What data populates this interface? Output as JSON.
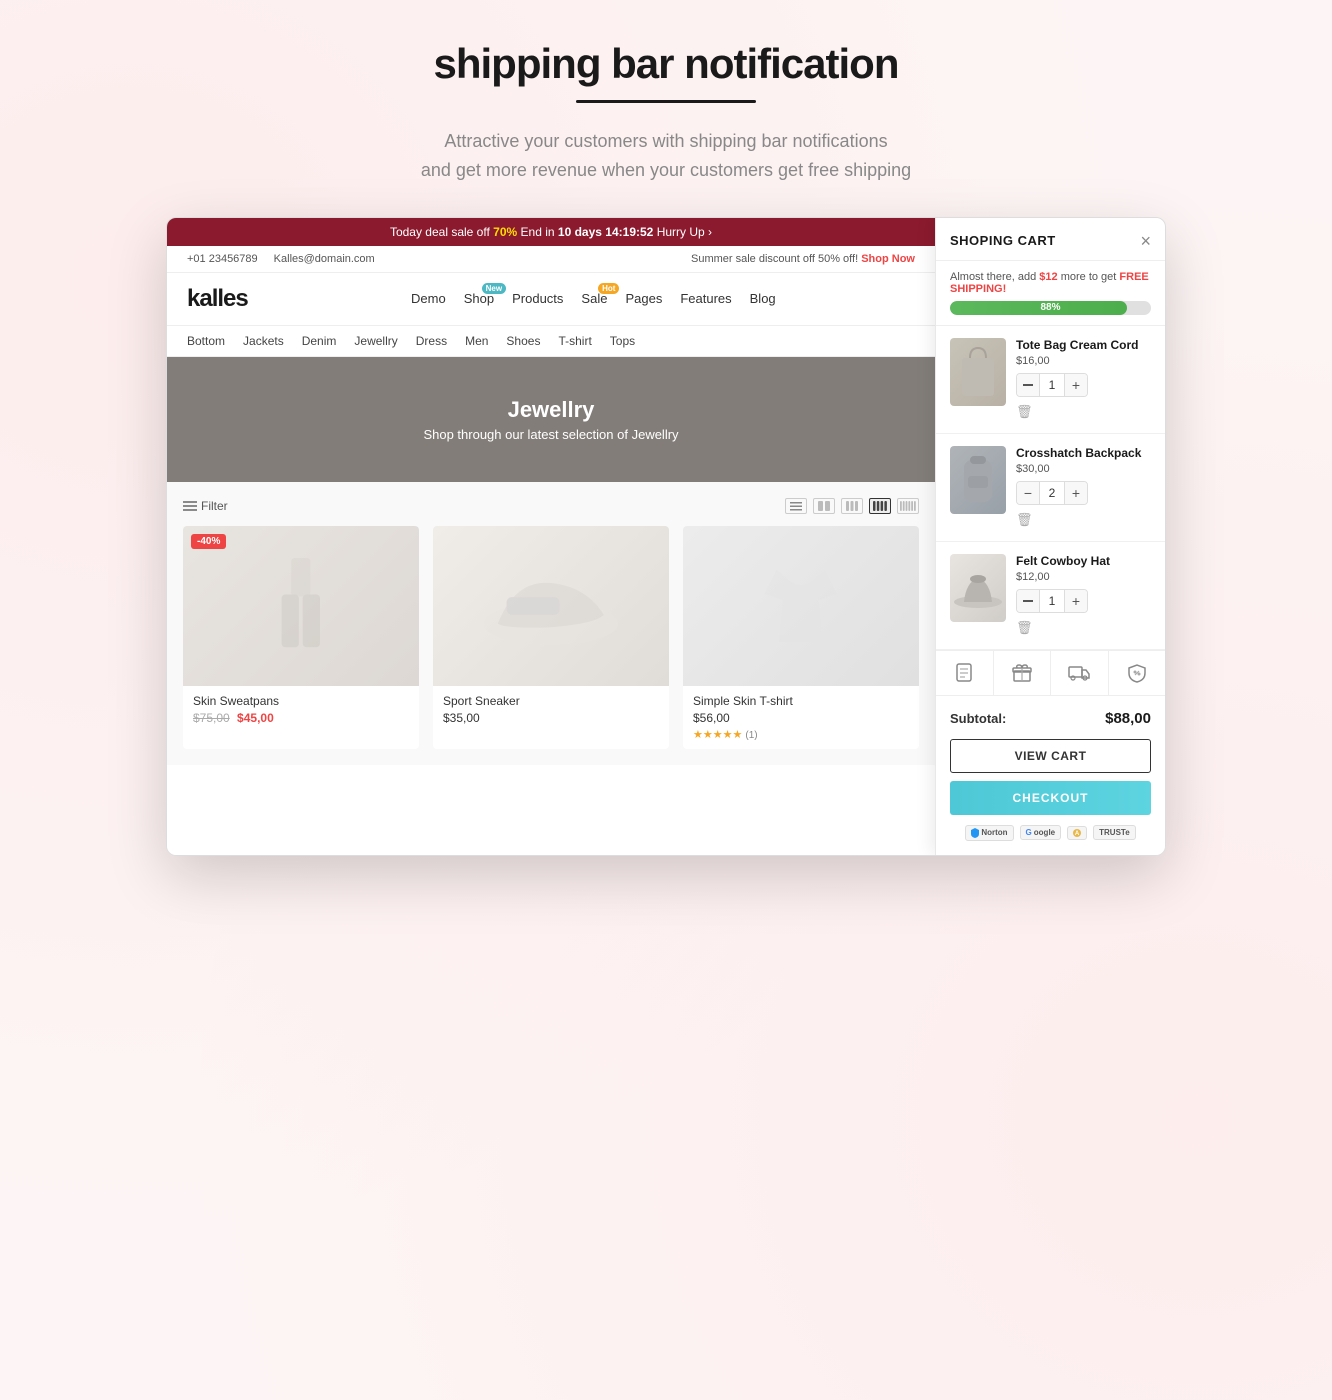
{
  "page": {
    "title": "shipping bar notification",
    "title_underline": true,
    "subtitle_line1": "Attractive your customers with shipping bar notifications",
    "subtitle_line2": "and get more revenue when your customers get free shipping"
  },
  "deal_bar": {
    "text_prefix": "Today deal sale off",
    "discount": "70%",
    "end_text": "End in",
    "days": "10 days",
    "timer": "14:19:52",
    "suffix": "Hurry Up"
  },
  "secondary_bar": {
    "phone": "+01 23456789",
    "email": "Kalles@domain.com",
    "sale_text": "Summer sale discount off",
    "sale_amount": "50% off!",
    "shop_now": "Shop Now"
  },
  "nav": {
    "logo": "kalles",
    "links": [
      {
        "label": "Demo"
      },
      {
        "label": "Shop",
        "badge": "New",
        "badge_color": "teal"
      },
      {
        "label": "Products"
      },
      {
        "label": "Sale",
        "badge": "Hot",
        "badge_color": "orange"
      },
      {
        "label": "Pages"
      },
      {
        "label": "Features"
      },
      {
        "label": "Blog"
      }
    ]
  },
  "categories": [
    "Bottom",
    "Jackets",
    "Denim",
    "Jewellry",
    "Dress",
    "Men",
    "Shoes",
    "T-shirt",
    "Tops"
  ],
  "hero": {
    "category": "Jewellry",
    "subtitle": "Shop through our latest selection of Jewellry"
  },
  "products_toolbar": {
    "filter_label": "Filter"
  },
  "products": [
    {
      "name": "Skin Sweatpans",
      "original_price": "$75,00",
      "sale_price": "$45,00",
      "badge": "-40%",
      "has_badge": true,
      "has_stars": false,
      "image_type": "sweatpants"
    },
    {
      "name": "Sport Sneaker",
      "price": "$35,00",
      "has_badge": false,
      "has_stars": false,
      "image_type": "sneaker"
    },
    {
      "name": "Simple Skin T-shirt",
      "price": "$56,00",
      "has_badge": false,
      "has_stars": true,
      "stars": 5,
      "review_count": "(1)",
      "image_type": "tshirt"
    }
  ],
  "cart": {
    "title": "SHOPING CART",
    "shipping_notice": "Almost there, add",
    "shipping_amount": "$12",
    "shipping_suffix": "more to get",
    "shipping_free": "FREE SHIPPING!",
    "progress_percent": 88,
    "progress_label": "88%",
    "items": [
      {
        "name": "Tote Bag Cream Cord",
        "price": "$16,00",
        "qty": 1,
        "image_type": "tote"
      },
      {
        "name": "Crosshatch Backpack",
        "price": "$30,00",
        "qty": 2,
        "image_type": "backpack"
      },
      {
        "name": "Felt Cowboy Hat",
        "price": "$12,00",
        "qty": 1,
        "image_type": "hat"
      }
    ],
    "extras": [
      {
        "icon": "📋",
        "label": "note"
      },
      {
        "icon": "🎁",
        "label": "gift"
      },
      {
        "icon": "🚚",
        "label": "shipping"
      },
      {
        "icon": "🏷",
        "label": "coupon"
      }
    ],
    "subtotal_label": "Subtotal:",
    "subtotal_value": "$88,00",
    "view_cart_label": "VIEW CART",
    "checkout_label": "CHECKOUT",
    "trust_badges": [
      "Norton",
      "Google",
      "Authorize",
      "TRUSTe"
    ]
  }
}
